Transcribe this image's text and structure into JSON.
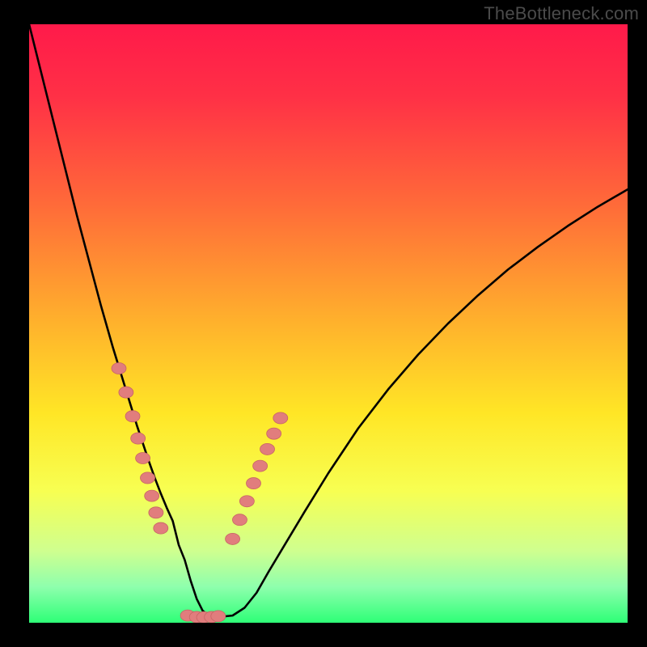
{
  "watermark": "TheBottleneck.com",
  "colors": {
    "page_bg": "#000000",
    "gradient_stops": [
      {
        "offset": 0.0,
        "color": "#ff1a4a"
      },
      {
        "offset": 0.12,
        "color": "#ff3046"
      },
      {
        "offset": 0.3,
        "color": "#ff6a39"
      },
      {
        "offset": 0.5,
        "color": "#ffb22c"
      },
      {
        "offset": 0.65,
        "color": "#ffe626"
      },
      {
        "offset": 0.78,
        "color": "#f7ff52"
      },
      {
        "offset": 0.88,
        "color": "#cfff8f"
      },
      {
        "offset": 0.94,
        "color": "#8effad"
      },
      {
        "offset": 1.0,
        "color": "#2eff77"
      }
    ],
    "curve": "#000000",
    "marker_fill": "#e17d7d",
    "marker_stroke": "#c76565"
  },
  "chart_data": {
    "type": "line",
    "title": "",
    "xlabel": "",
    "ylabel": "",
    "xlim": [
      0,
      100
    ],
    "ylim": [
      0,
      100
    ],
    "x": [
      0,
      2,
      4,
      6,
      8,
      10,
      12,
      14,
      16,
      18,
      20,
      21,
      22,
      23,
      24,
      25,
      26,
      27,
      28,
      29,
      30,
      32,
      34,
      36,
      38,
      40,
      43,
      46,
      50,
      55,
      60,
      65,
      70,
      75,
      80,
      85,
      90,
      95,
      100
    ],
    "values": [
      100,
      92,
      84,
      76,
      68,
      60.5,
      53,
      46,
      39.5,
      33,
      27,
      24.2,
      21.6,
      19.2,
      17,
      13,
      10.5,
      7,
      4,
      2,
      1.2,
      1.0,
      1.2,
      2.5,
      5,
      8.5,
      13.5,
      18.5,
      25,
      32.5,
      39,
      44.8,
      50,
      54.7,
      59,
      62.8,
      66.3,
      69.5,
      72.4
    ],
    "series": [
      {
        "name": "left-markers",
        "x": [
          15,
          16.2,
          17.3,
          18.2,
          19.0,
          19.8,
          20.5,
          21.2,
          22.0
        ],
        "y": [
          42.5,
          38.5,
          34.5,
          30.8,
          27.5,
          24.2,
          21.2,
          18.4,
          15.8
        ]
      },
      {
        "name": "minimum-markers",
        "x": [
          26.5,
          28.0,
          29.2,
          30.5,
          31.6
        ],
        "y": [
          1.2,
          0.95,
          0.9,
          0.95,
          1.1
        ]
      },
      {
        "name": "right-markers",
        "x": [
          34.0,
          35.2,
          36.4,
          37.5,
          38.6,
          39.8,
          40.9,
          42.0
        ],
        "y": [
          14.0,
          17.2,
          20.3,
          23.3,
          26.2,
          29.0,
          31.6,
          34.2
        ]
      }
    ],
    "marker_radius_px": 9
  }
}
